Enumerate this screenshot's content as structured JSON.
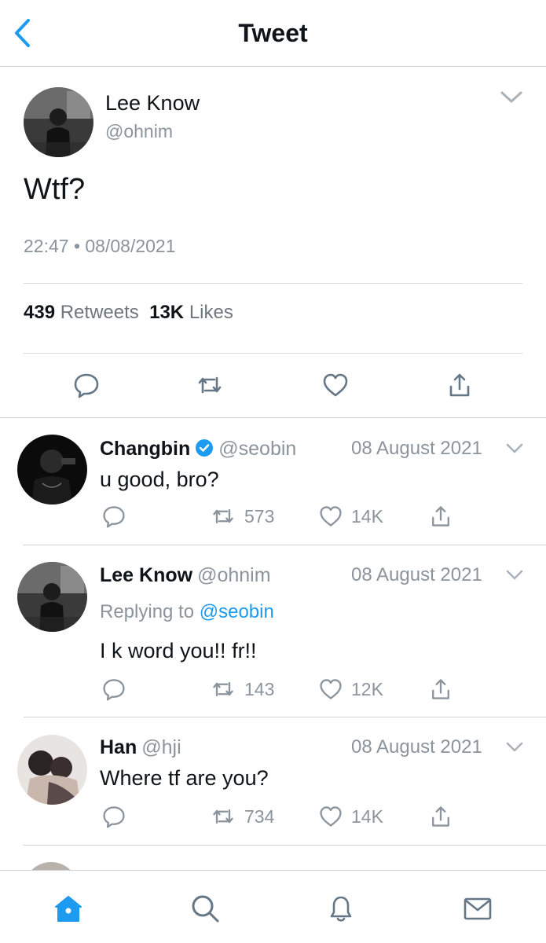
{
  "header": {
    "title": "Tweet"
  },
  "main_tweet": {
    "name": "Lee Know",
    "handle": "@ohnim",
    "text": "Wtf?",
    "timestamp": "22:47 • 08/08/2021",
    "retweets_count": "439",
    "retweets_label": "Retweets",
    "likes_count": "13K",
    "likes_label": "Likes"
  },
  "replies": [
    {
      "name": "Changbin",
      "handle": "@seobin",
      "date": "08 August 2021",
      "text": "u good, bro?",
      "retweets": "573",
      "likes": "14K"
    },
    {
      "name": "Lee Know",
      "handle": "@ohnim",
      "date": "08 August 2021",
      "replying_label": "Replying to",
      "replying_to": "@seobin",
      "text": "I k word you!! fr!!",
      "retweets": "143",
      "likes": "12K"
    },
    {
      "name": "Han",
      "handle": "@hji",
      "date": "08 August 2021",
      "text": "Where tf are you?",
      "retweets": "734",
      "likes": "14K"
    }
  ],
  "colors": {
    "accent": "#1d9bf0",
    "muted": "#8b949c",
    "text": "#0f1419"
  },
  "icons": [
    "back-arrow-icon",
    "chevron-down-icon",
    "reply-icon",
    "retweet-icon",
    "like-icon",
    "share-icon",
    "verified-icon",
    "home-icon",
    "search-icon",
    "notifications-icon",
    "messages-icon"
  ]
}
